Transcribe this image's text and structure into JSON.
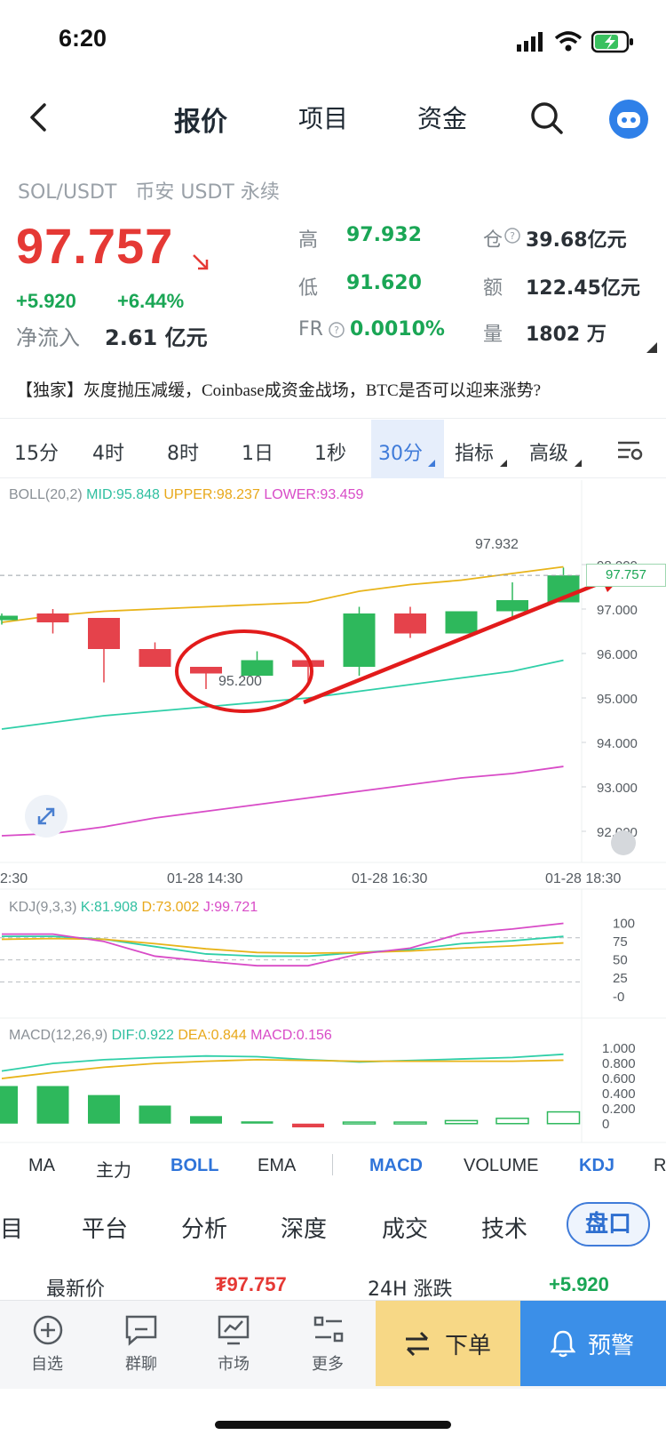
{
  "status_bar": {
    "time": "6:20"
  },
  "header": {
    "tabs": [
      {
        "label": "报价",
        "active": true
      },
      {
        "label": "项目",
        "active": false
      },
      {
        "label": "资金",
        "active": false
      }
    ]
  },
  "ticker": {
    "pair": "SOL/USDT",
    "market": "币安 USDT 永续",
    "price": "97.757",
    "change_abs": "+5.920",
    "change_pct": "+6.44%",
    "net_inflow_label": "净流入",
    "net_inflow_value": "2.61 亿元",
    "high_label": "高",
    "high_value": "97.932",
    "low_label": "低",
    "low_value": "91.620",
    "fr_label": "FR",
    "fr_value": "0.0010%",
    "oi_label": "仓",
    "oi_value": "39.68亿元",
    "turnover_label": "额",
    "turnover_value": "122.45亿元",
    "volume_label": "量",
    "volume_value": "1802 万"
  },
  "news": "【独家】灰度抛压减缓，Coinbase成资金战场，BTC是否可以迎来涨势?",
  "timeframes": [
    "15分",
    "4时",
    "8时",
    "1日",
    "1秒",
    "30分",
    "指标",
    "高级"
  ],
  "main_chart": {
    "legend_name": "BOLL(20,2)",
    "mid": "MID:95.848",
    "upper": "UPPER:98.237",
    "lower": "LOWER:93.459",
    "y_ticks": [
      "98.000",
      "97.000",
      "96.000",
      "95.000",
      "94.000",
      "93.000",
      "92.000"
    ],
    "x_ticks": [
      "2:30",
      "01-28 14:30",
      "01-28 16:30",
      "01-28 18:30"
    ],
    "high_marker": "97.932",
    "low_marker": "95.200",
    "current_price_tag": "97.757"
  },
  "kdj": {
    "legend_name": "KDJ(9,3,3)",
    "k": "K:81.908",
    "d": "D:73.002",
    "j": "J:99.721",
    "y_ticks": [
      "100",
      "75",
      "50",
      "25",
      "-0"
    ]
  },
  "macd": {
    "legend_name": "MACD(12,26,9)",
    "dif": "DIF:0.922",
    "dea": "DEA:0.844",
    "macd": "MACD:0.156",
    "y_ticks": [
      "1.000",
      "0.800",
      "0.600",
      "0.400",
      "0.200",
      "0"
    ]
  },
  "indicator_tabs": [
    {
      "label": "MA",
      "active": false
    },
    {
      "label": "主力",
      "active": false
    },
    {
      "label": "BOLL",
      "active": true
    },
    {
      "label": "EMA",
      "active": false
    },
    {
      "label": "MACD",
      "active": true
    },
    {
      "label": "VOLUME",
      "active": false
    },
    {
      "label": "KDJ",
      "active": true
    },
    {
      "label": "R",
      "active": false
    }
  ],
  "section_tabs": [
    "项目",
    "平台",
    "分析",
    "深度",
    "成交",
    "技术",
    "盘口"
  ],
  "quote_row": {
    "latest_label": "最新价",
    "latest_value": "₮97.757",
    "change_label": "24H 涨跌",
    "change_value": "+5.920"
  },
  "bottom_nav": {
    "items": [
      "自选",
      "群聊",
      "市场",
      "更多"
    ],
    "order_label": "下单",
    "alert_label": "预警"
  },
  "chart_data": {
    "type": "candlestick",
    "x_ticks": [
      "2:30",
      "01-28 14:30",
      "01-28 16:30",
      "01-28 18:30"
    ],
    "ylim": [
      91.7,
      98.5
    ],
    "candles": [
      {
        "open": 96.75,
        "close": 96.85,
        "high": 96.9,
        "low": 96.65
      },
      {
        "open": 96.9,
        "close": 96.7,
        "high": 97.0,
        "low": 96.45
      },
      {
        "open": 96.8,
        "close": 96.1,
        "high": 96.8,
        "low": 95.35
      },
      {
        "open": 96.1,
        "close": 95.7,
        "high": 96.25,
        "low": 95.7
      },
      {
        "open": 95.7,
        "close": 95.55,
        "high": 95.7,
        "low": 95.2
      },
      {
        "open": 95.5,
        "close": 95.85,
        "high": 96.05,
        "low": 95.5
      },
      {
        "open": 95.85,
        "close": 95.7,
        "high": 95.95,
        "low": 95.35
      },
      {
        "open": 95.7,
        "close": 96.9,
        "high": 97.05,
        "low": 95.5
      },
      {
        "open": 96.9,
        "close": 96.45,
        "high": 97.05,
        "low": 96.35
      },
      {
        "open": 96.45,
        "close": 96.95,
        "high": 96.95,
        "low": 96.45
      },
      {
        "open": 96.95,
        "close": 97.2,
        "high": 97.6,
        "low": 96.8
      },
      {
        "open": 97.15,
        "close": 97.757,
        "high": 97.932,
        "low": 97.15
      }
    ],
    "boll_upper": [
      96.7,
      96.85,
      96.95,
      97.0,
      97.05,
      97.1,
      97.15,
      97.4,
      97.55,
      97.65,
      97.8,
      97.95
    ],
    "boll_mid": [
      94.3,
      94.45,
      94.6,
      94.7,
      94.8,
      94.9,
      95.0,
      95.15,
      95.3,
      95.45,
      95.6,
      95.848
    ],
    "boll_lower": [
      91.9,
      91.95,
      92.1,
      92.3,
      92.45,
      92.6,
      92.75,
      92.9,
      93.05,
      93.2,
      93.3,
      93.459
    ],
    "kdj": {
      "ylim": [
        -5,
        110
      ],
      "k": [
        82,
        82,
        78,
        68,
        58,
        55,
        55,
        60,
        64,
        72,
        76,
        81.908
      ],
      "d": [
        78,
        79,
        78,
        72,
        65,
        60,
        59,
        60,
        62,
        66,
        69,
        73.002
      ],
      "j": [
        85,
        85,
        75,
        55,
        48,
        42,
        42,
        58,
        66,
        86,
        92,
        99.721
      ]
    },
    "macd": {
      "ylim": [
        -0.05,
        1.05
      ],
      "dif": [
        0.7,
        0.8,
        0.85,
        0.88,
        0.9,
        0.89,
        0.85,
        0.82,
        0.84,
        0.86,
        0.88,
        0.922
      ],
      "dea": [
        0.6,
        0.68,
        0.75,
        0.8,
        0.83,
        0.85,
        0.84,
        0.83,
        0.83,
        0.83,
        0.83,
        0.844
      ],
      "hist": [
        0.5,
        0.5,
        0.38,
        0.24,
        0.1,
        0.03,
        -0.05,
        0.02,
        0.02,
        0.04,
        0.07,
        0.156
      ]
    }
  }
}
